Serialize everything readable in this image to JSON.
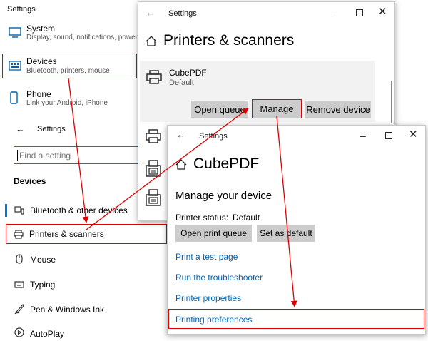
{
  "win1": {
    "title": "Settings",
    "items": [
      {
        "label": "System",
        "sub": "Display, sound, notifications, power",
        "icon": "monitor-icon"
      },
      {
        "label": "Devices",
        "sub": "Bluetooth, printers, mouse",
        "icon": "keyboard-icon"
      },
      {
        "label": "Phone",
        "sub": "Link your Android, iPhone",
        "icon": "phone-icon"
      }
    ]
  },
  "win2": {
    "title": "Settings",
    "search_placeholder": "Find a setting",
    "section": "Devices",
    "nav": [
      {
        "label": "Bluetooth & other devices",
        "icon": "bluetooth-devices-icon"
      },
      {
        "label": "Printers & scanners",
        "icon": "printer-icon"
      },
      {
        "label": "Mouse",
        "icon": "mouse-icon"
      },
      {
        "label": "Typing",
        "icon": "keyboard-icon"
      },
      {
        "label": "Pen & Windows Ink",
        "icon": "pen-icon"
      },
      {
        "label": "AutoPlay",
        "icon": "autoplay-icon"
      }
    ]
  },
  "win3": {
    "title": "Settings",
    "heading": "Printers & scanners",
    "printer_name": "CubePDF",
    "printer_status": "Default",
    "buttons": {
      "open_queue": "Open queue",
      "manage": "Manage",
      "remove": "Remove device"
    }
  },
  "win4": {
    "title": "Settings",
    "heading": "CubePDF",
    "subheading": "Manage your device",
    "status_label": "Printer status:",
    "status_value": "Default",
    "buttons": {
      "open_print_queue": "Open print queue",
      "set_default": "Set as default"
    },
    "links": {
      "test_page": "Print a test page",
      "troubleshooter": "Run the troubleshooter",
      "properties": "Printer properties",
      "preferences": "Printing preferences"
    }
  },
  "colors": {
    "highlight": "#e00000",
    "link": "#0063b1",
    "button": "#cccccc"
  }
}
